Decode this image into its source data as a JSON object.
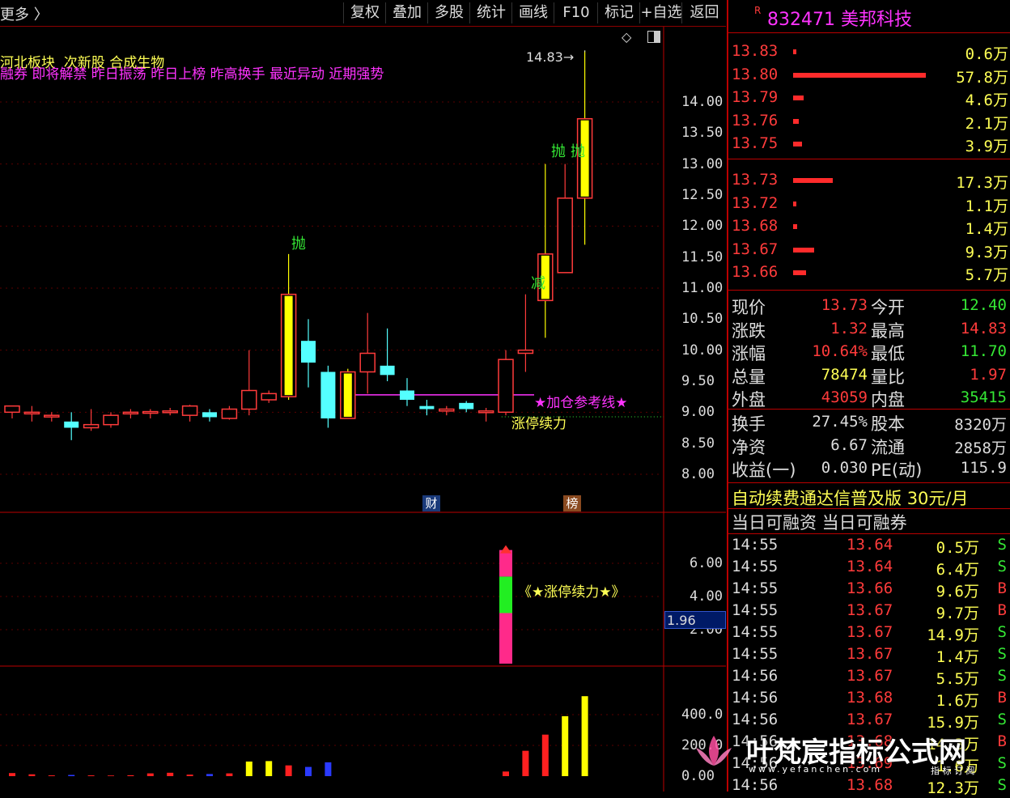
{
  "toolbar": {
    "left_label": "更多",
    "buttons": [
      "复权",
      "叠加",
      "多股",
      "统计",
      "画线",
      "F10",
      "标记",
      "+自选",
      "返回"
    ]
  },
  "stock": {
    "badge": "R",
    "code": "832471",
    "name": "美邦科技"
  },
  "tags_line1": "河北板块  次新股 合成生物",
  "tags_line2": "融券 即将解禁 昨日振荡 昨日上榜 昨高换手 最近异动 近期强势",
  "annotations": {
    "high_label": "14.83",
    "throw1": "抛",
    "throw2": "抛",
    "throw3": "抛",
    "reduce": "减",
    "add_ref_line": "★加仓参考线★",
    "limit_up": "涨停续力",
    "indicator_label": "《★涨停续力★》",
    "badge_cai": "财",
    "badge_bang": "榜",
    "cursor_value": "1.96"
  },
  "price_axis": [
    "14.00",
    "13.50",
    "13.00",
    "12.50",
    "12.00",
    "11.50",
    "11.00",
    "10.50",
    "10.00",
    "9.50",
    "9.00",
    "8.50",
    "8.00"
  ],
  "ind_axis": [
    "6.00",
    "4.00",
    "2.00"
  ],
  "vol_axis": [
    "400.0",
    "200.0",
    "0.00"
  ],
  "chart_data": {
    "type": "candlestick",
    "candles": [
      {
        "o": 9.0,
        "h": 9.1,
        "l": 8.9,
        "c": 9.1
      },
      {
        "o": 9.0,
        "h": 9.1,
        "l": 8.85,
        "c": 9.0
      },
      {
        "o": 8.95,
        "h": 9.0,
        "l": 8.85,
        "c": 8.95
      },
      {
        "o": 8.85,
        "h": 9.0,
        "l": 8.55,
        "c": 8.75
      },
      {
        "o": 8.75,
        "h": 9.05,
        "l": 8.7,
        "c": 8.8
      },
      {
        "o": 8.8,
        "h": 9.0,
        "l": 8.75,
        "c": 8.95
      },
      {
        "o": 8.98,
        "h": 9.05,
        "l": 8.9,
        "c": 9.0
      },
      {
        "o": 8.99,
        "h": 9.05,
        "l": 8.9,
        "c": 9.01
      },
      {
        "o": 9.0,
        "h": 9.07,
        "l": 8.95,
        "c": 9.02
      },
      {
        "o": 8.95,
        "h": 9.12,
        "l": 8.85,
        "c": 9.1
      },
      {
        "o": 9.0,
        "h": 9.05,
        "l": 8.85,
        "c": 8.92
      },
      {
        "o": 8.9,
        "h": 9.1,
        "l": 8.88,
        "c": 9.05
      },
      {
        "o": 9.05,
        "h": 10.0,
        "l": 8.95,
        "c": 9.35
      },
      {
        "o": 9.2,
        "h": 9.35,
        "l": 9.15,
        "c": 9.3
      },
      {
        "o": 9.25,
        "h": 11.55,
        "l": 9.2,
        "c": 10.9
      },
      {
        "o": 10.15,
        "h": 10.5,
        "l": 9.4,
        "c": 9.8
      },
      {
        "o": 9.65,
        "h": 9.75,
        "l": 8.75,
        "c": 8.9
      },
      {
        "o": 8.9,
        "h": 9.7,
        "l": 8.9,
        "c": 9.65
      },
      {
        "o": 9.65,
        "h": 10.6,
        "l": 9.3,
        "c": 9.95
      },
      {
        "o": 9.75,
        "h": 10.35,
        "l": 9.5,
        "c": 9.6
      },
      {
        "o": 9.35,
        "h": 9.55,
        "l": 9.1,
        "c": 9.2
      },
      {
        "o": 9.1,
        "h": 9.2,
        "l": 8.95,
        "c": 9.05
      },
      {
        "o": 9.02,
        "h": 9.1,
        "l": 8.95,
        "c": 9.05
      },
      {
        "o": 9.15,
        "h": 9.18,
        "l": 9.0,
        "c": 9.05
      },
      {
        "o": 9.02,
        "h": 9.07,
        "l": 8.85,
        "c": 9.02
      },
      {
        "o": 9.0,
        "h": 10.0,
        "l": 8.95,
        "c": 9.85
      },
      {
        "o": 9.95,
        "h": 10.9,
        "l": 9.65,
        "c": 10.0
      },
      {
        "o": 10.8,
        "h": 13.0,
        "l": 10.2,
        "c": 11.55
      },
      {
        "o": 11.25,
        "h": 13.0,
        "l": 11.25,
        "c": 12.45
      },
      {
        "o": 12.45,
        "h": 14.83,
        "l": 11.7,
        "c": 13.73
      }
    ],
    "volumes": [
      20,
      12,
      5,
      8,
      5,
      4,
      6,
      18,
      22,
      10,
      14,
      18,
      95,
      98,
      70,
      60,
      90,
      0,
      0,
      0,
      0,
      0,
      0,
      0,
      0,
      30,
      165,
      270,
      390,
      520
    ],
    "add_ref_price": 9.28,
    "limit_ref_price": 8.9,
    "indicator_value": 1.96,
    "indicator_bar": {
      "pink_low": 0,
      "pink_high": 3.0,
      "green_high": 5.2,
      "top": 6.8
    }
  },
  "orderbook_sell": [
    {
      "price": "13.83",
      "vol": "0.6万",
      "bar": 0.01
    },
    {
      "price": "13.80",
      "vol": "57.8万",
      "bar": 1.0
    },
    {
      "price": "13.79",
      "vol": "4.6万",
      "bar": 0.08
    },
    {
      "price": "13.76",
      "vol": "2.1万",
      "bar": 0.04
    },
    {
      "price": "13.75",
      "vol": "3.9万",
      "bar": 0.07
    }
  ],
  "orderbook_buy": [
    {
      "price": "13.73",
      "vol": "17.3万",
      "bar": 0.3
    },
    {
      "price": "13.72",
      "vol": "1.1万",
      "bar": 0.02
    },
    {
      "price": "13.68",
      "vol": "1.4万",
      "bar": 0.03
    },
    {
      "price": "13.67",
      "vol": "9.3万",
      "bar": 0.16
    },
    {
      "price": "13.66",
      "vol": "5.7万",
      "bar": 0.1
    }
  ],
  "quote": [
    {
      "l1": "现价",
      "v1": "13.73",
      "c1": "#ff3b3b",
      "l2": "今开",
      "v2": "12.40",
      "c2": "#35e835"
    },
    {
      "l1": "涨跌",
      "v1": "1.32",
      "c1": "#ff3b3b",
      "l2": "最高",
      "v2": "14.83",
      "c2": "#ff3b3b"
    },
    {
      "l1": "涨幅",
      "v1": "10.64%",
      "c1": "#ff3b3b",
      "l2": "最低",
      "v2": "11.70",
      "c2": "#35e835"
    },
    {
      "l1": "总量",
      "v1": "78474",
      "c1": "#ffff55",
      "l2": "量比",
      "v2": "1.97",
      "c2": "#ff3b3b"
    },
    {
      "l1": "外盘",
      "v1": "43059",
      "c1": "#ff3b3b",
      "l2": "内盘",
      "v2": "35415",
      "c2": "#35e835"
    }
  ],
  "fund": [
    {
      "l1": "换手",
      "v1": "27.45%",
      "l2": "股本",
      "v2": "8320万"
    },
    {
      "l1": "净资",
      "v1": "6.67",
      "l2": "流通",
      "v2": "2858万"
    },
    {
      "l1": "收益(一)",
      "v1": "0.030",
      "l2": "PE(动)",
      "v2": "115.9"
    }
  ],
  "promo": {
    "text": "自动续费通达信普及版",
    "price": "30元/月"
  },
  "margin": "当日可融资 当日可融券",
  "ticks": [
    {
      "t": "14:55",
      "p": "13.64",
      "v": "0.5万",
      "s": "S"
    },
    {
      "t": "14:55",
      "p": "13.64",
      "v": "6.4万",
      "s": "S"
    },
    {
      "t": "14:55",
      "p": "13.66",
      "v": "9.6万",
      "s": "B"
    },
    {
      "t": "14:55",
      "p": "13.67",
      "v": "9.7万",
      "s": "B"
    },
    {
      "t": "14:55",
      "p": "13.67",
      "v": "14.9万",
      "s": "S"
    },
    {
      "t": "14:55",
      "p": "13.67",
      "v": "1.4万",
      "s": "S"
    },
    {
      "t": "14:56",
      "p": "13.67",
      "v": "5.5万",
      "s": "S"
    },
    {
      "t": "14:56",
      "p": "13.68",
      "v": "1.6万",
      "s": "B"
    },
    {
      "t": "14:56",
      "p": "13.67",
      "v": "15.9万",
      "s": "S"
    },
    {
      "t": "14:56",
      "p": "13.68",
      "v": "14.3万",
      "s": "B"
    },
    {
      "t": "14:56",
      "p": "13.69",
      "v": "1.6万",
      "s": "S"
    },
    {
      "t": "14:56",
      "p": "13.68",
      "v": "12.3万",
      "s": "S"
    }
  ],
  "watermark": {
    "main": "叶梵宸指标公式网",
    "sub": "www.yefanchen.com",
    "sub2": "指 标 订 阅"
  },
  "colors": {
    "up": "#ff3b3b",
    "down": "#54ffff",
    "highlight": "#ffff00",
    "magenta": "#ff33ff",
    "green": "#35e835"
  }
}
